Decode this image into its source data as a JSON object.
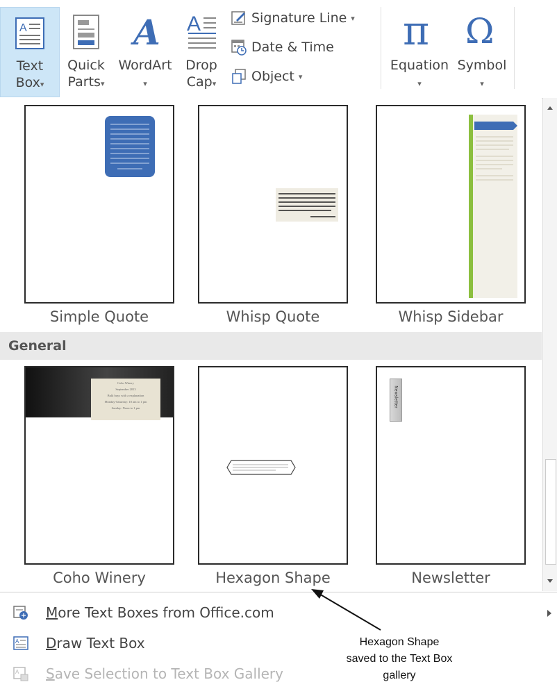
{
  "ribbon": {
    "text_box": {
      "line1": "Text",
      "line2": "Box"
    },
    "quick_parts": {
      "line1": "Quick",
      "line2": "Parts"
    },
    "wordart": {
      "label": "WordArt"
    },
    "drop_cap": {
      "line1": "Drop",
      "line2": "Cap"
    },
    "signature_line": "Signature Line",
    "date_time": "Date & Time",
    "object": "Object",
    "equation": "Equation",
    "symbol": "Symbol",
    "dropdown_glyph": "▾"
  },
  "gallery": {
    "row1": [
      {
        "name": "Simple Quote"
      },
      {
        "name": "Whisp Quote"
      },
      {
        "name": "Whisp Sidebar"
      }
    ],
    "section_general": "General",
    "row2": [
      {
        "name": "Coho Winery"
      },
      {
        "name": "Hexagon Shape"
      },
      {
        "name": "Newsletter"
      }
    ],
    "thumb_text": {
      "coho": [
        "Coho Winery",
        "September 2013",
        "Bulk buys with a explanation",
        "Monday-Saturday: 10 am to 1 pm",
        "Sunday: Noon to 1 pm"
      ],
      "newsletter": "Newsletter"
    }
  },
  "menu": {
    "more_text_boxes": "More Text Boxes from Office.com",
    "draw_text_box": "Draw Text Box",
    "save_selection": "Save Selection to Text Box Gallery"
  },
  "annotation": {
    "line1": "Hexagon Shape",
    "line2": "saved to the Text Box",
    "line3": "gallery"
  },
  "colors": {
    "selected_bg": "#cde6f7",
    "word_blue": "#3e6db5",
    "green_bar": "#8cbf3f",
    "section_bg": "#e9e9e9"
  }
}
